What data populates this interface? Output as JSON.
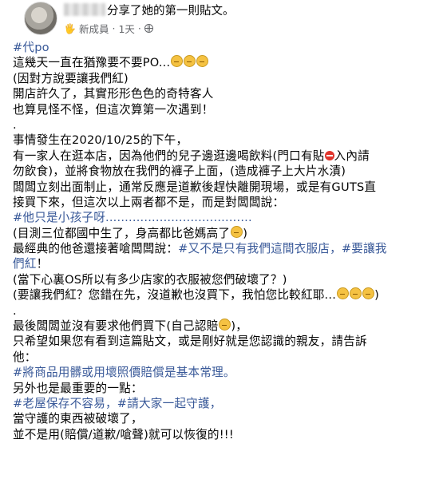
{
  "post": {
    "shared_text": "分享了她的第一則貼文。",
    "member_badge": "新成員",
    "time": "1天"
  },
  "body": {
    "tag_daipo": "#代po",
    "l2": "這幾天一直在猶豫要不要PO...",
    "l3": "(因對方說要讓我們紅)",
    "l4": "開店許久了，其實形形色色的奇特客人",
    "l5": "也算見怪不怪，但這次算第一次遇到！",
    "l6": ".",
    "l7": "事情發生在2020/10/25的下午，",
    "l8": "有一家人在逛本店，因為他們的兒子邊逛邊喝飲料(門口有貼",
    "l8b": "入內請",
    "l9": "勿飲食)，並將食物放在我們的褲子上面，(造成褲子上大片水漬)",
    "l10": "闆闆立刻出面制止，通常反應是道歉後趕快離開現場，或是有GUTS直",
    "l11": "接買下來，但這次以上兩者都不是，而是對闆闆說：",
    "tag_child": "#他只是小孩子呀......................................",
    "l13": "(目測三位都國中生了，身高都比爸媽高了",
    "l13b": ")",
    "l14a": "最經典的他爸還接著嗆闆闆說：",
    "tag_shop": "#又不是只有我們這間衣服店，#要讓我",
    "tag_shop2": "們紅",
    "l15b": "！",
    "l16": "(當下心裏OS所以有多少店家的衣服被您們破壞了？)",
    "l17": "(要讓我們紅？您錯在先，沒道歉也沒買下，我怕您比較紅耶...",
    "l17b": ")",
    "l18": ".",
    "l19": "最後闆闆並沒有要求他們買下(自己認賠",
    "l19b": ")，",
    "l20": "只希望如果您有看到這篇貼文，或是剛好就是您認識的親友，請告訴",
    "l21": "他：",
    "tag_rule": "#將商品用髒或用壞照價賠償是基本常理。",
    "l23": "另外也是最重要的一點：",
    "tag_old": "#老屋保存不容易，#請大家一起守護，",
    "l25": "當守護的東西被破壞了，",
    "l26": "並不是用(賠償/道歉/嗆聲)就可以恢復的!!!"
  }
}
